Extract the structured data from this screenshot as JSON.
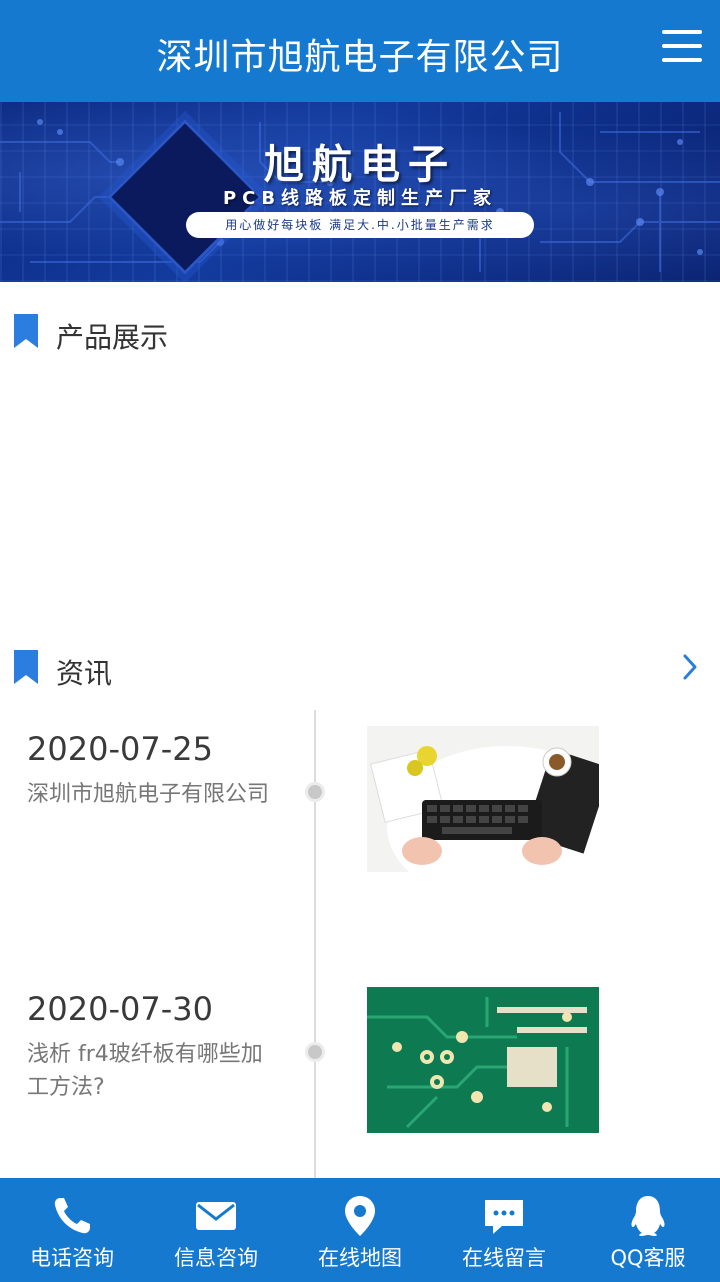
{
  "header": {
    "title": "深圳市旭航电子有限公司",
    "menu_icon": "hamburger-menu-icon"
  },
  "banner": {
    "title": "旭航电子",
    "subtitle": "PCB线路板定制生产厂家",
    "tagline": "用心做好每块板  满足大.中.小批量生产需求"
  },
  "products": {
    "title": "产品展示",
    "icon": "bookmark-icon"
  },
  "news": {
    "title": "资讯",
    "icon": "bookmark-icon",
    "more_icon": "chevron-right-icon",
    "items": [
      {
        "date": "2020-07-25",
        "text": "深圳市旭航电子有限公司",
        "thumb": "keyboard-desk-photo"
      },
      {
        "date": "2020-07-30",
        "text": "浅析 fr4玻纤板有哪些加工方法?",
        "thumb": "green-pcb-photo"
      }
    ]
  },
  "bottom_nav": [
    {
      "label": "电话咨询",
      "icon": "phone-icon"
    },
    {
      "label": "信息咨询",
      "icon": "envelope-icon"
    },
    {
      "label": "在线地图",
      "icon": "map-pin-icon"
    },
    {
      "label": "在线留言",
      "icon": "chat-bubble-icon"
    },
    {
      "label": "QQ客服",
      "icon": "qq-penguin-icon"
    }
  ],
  "colors": {
    "primary": "#1579d0",
    "accent_icon": "#2b7de0",
    "text_dark": "#333333",
    "text_muted": "#777777"
  }
}
